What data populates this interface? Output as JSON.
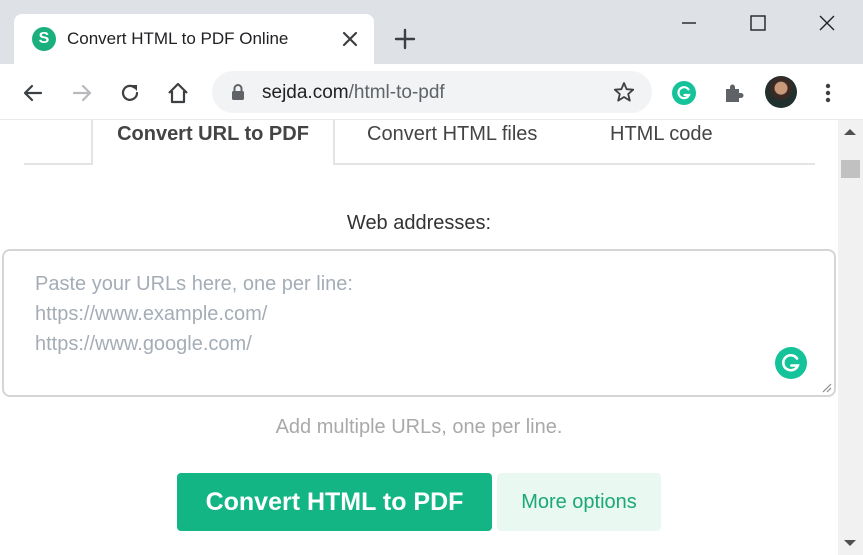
{
  "browser": {
    "tab": {
      "favicon_letter": "S",
      "title": "Convert HTML to PDF Online"
    },
    "address": {
      "host": "sejda.com",
      "path": "/html-to-pdf"
    }
  },
  "page": {
    "tabs": [
      {
        "label": "Convert URL to PDF",
        "active": true
      },
      {
        "label": "Convert HTML files",
        "active": false
      },
      {
        "label": "HTML code",
        "active": false
      }
    ],
    "field_label": "Web addresses:",
    "placeholder_lines": [
      "Paste your URLs here, one per line:",
      "https://www.example.com/",
      "https://www.google.com/"
    ],
    "hint": "Add multiple URLs, one per line.",
    "convert_button": "Convert HTML to PDF",
    "options_button": "More options"
  },
  "icons": {
    "back": "back-arrow-icon",
    "forward": "forward-arrow-icon",
    "reload": "reload-icon",
    "home": "home-icon",
    "lock": "lock-icon",
    "bookmark": "star-icon",
    "grammarly": "grammarly-icon",
    "extensions": "puzzle-icon",
    "menu": "kebab-menu-icon"
  },
  "colors": {
    "accent": "#14b584",
    "secondary_button_bg": "#eaf8f2",
    "grammarly": "#15c39a",
    "tab_strip": "#dee1e6"
  }
}
